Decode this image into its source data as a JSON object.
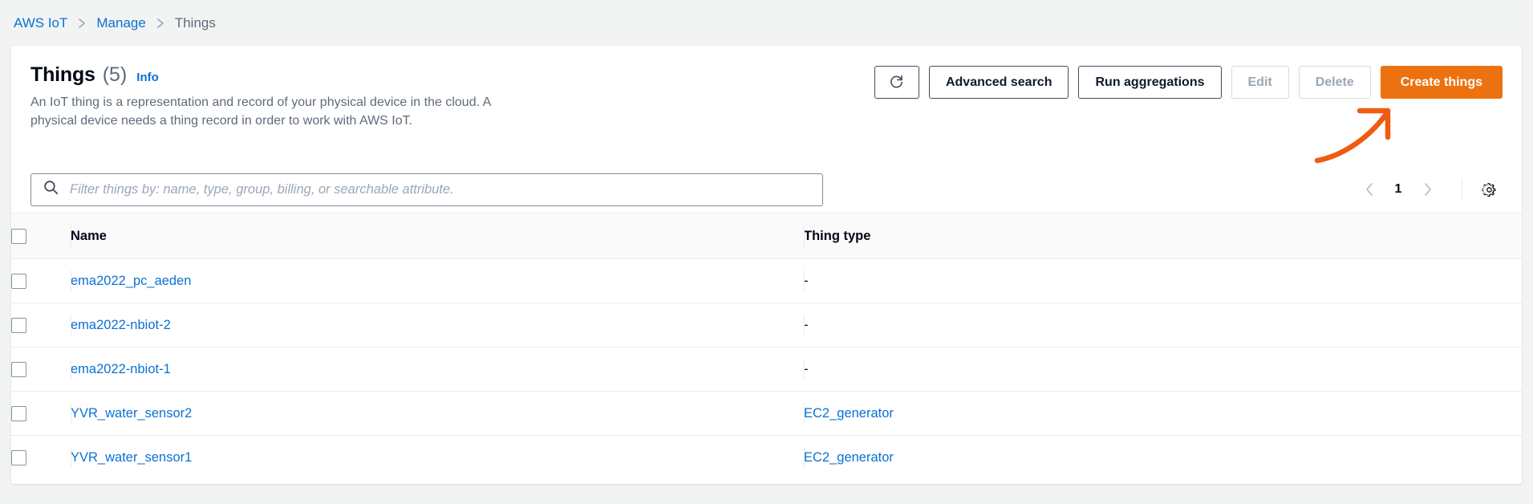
{
  "breadcrumb": {
    "items": [
      {
        "label": "AWS IoT",
        "type": "link"
      },
      {
        "label": "Manage",
        "type": "link"
      },
      {
        "label": "Things",
        "type": "current"
      }
    ]
  },
  "header": {
    "title": "Things",
    "count": "(5)",
    "info_label": "Info",
    "description_line1": "An IoT thing is a representation and record of your physical device in the cloud. A physical device",
    "description_line2": "needs a thing record in order to work with AWS IoT."
  },
  "toolbar": {
    "refresh_icon": "refresh-icon",
    "advanced_search_label": "Advanced search",
    "run_aggregations_label": "Run aggregations",
    "edit_label": "Edit",
    "delete_label": "Delete",
    "create_things_label": "Create things",
    "primary_color": "#ec7211"
  },
  "filter": {
    "placeholder": "Filter things by: name, type, group, billing, or searchable attribute.",
    "value": "",
    "search_icon": "search-icon"
  },
  "pagination": {
    "prev_icon": "chevron-left-icon",
    "page": "1",
    "next_icon": "chevron-right-icon",
    "settings_icon": "gear-icon"
  },
  "table": {
    "columns": [
      {
        "key": "name",
        "label": "Name"
      },
      {
        "key": "type",
        "label": "Thing type"
      }
    ],
    "rows": [
      {
        "name": "ema2022_pc_aeden",
        "type": "-",
        "type_is_link": false
      },
      {
        "name": "ema2022-nbiot-2",
        "type": "-",
        "type_is_link": false
      },
      {
        "name": "ema2022-nbiot-1",
        "type": "-",
        "type_is_link": false
      },
      {
        "name": "YVR_water_sensor2",
        "type": "EC2_generator",
        "type_is_link": true
      },
      {
        "name": "YVR_water_sensor1",
        "type": "EC2_generator",
        "type_is_link": true
      }
    ]
  },
  "annotation": {
    "shape": "curved-arrow-up-right",
    "color": "#ef5b10",
    "points_to": "create-things-button"
  }
}
